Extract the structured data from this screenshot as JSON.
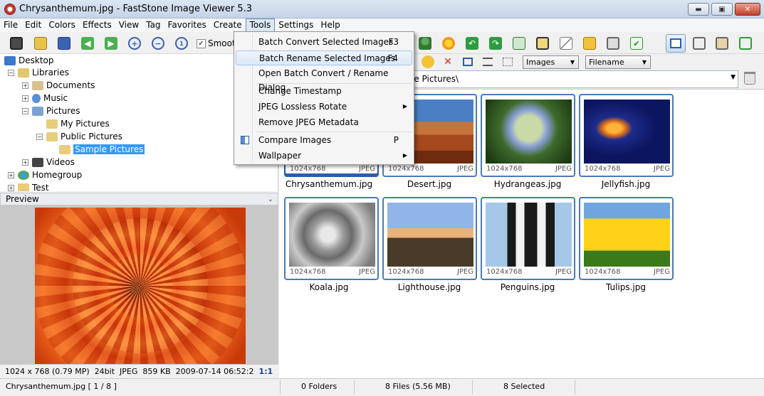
{
  "window": {
    "title": "Chrysanthemum.jpg - FastStone Image Viewer 5.3",
    "min_glyph": "▬",
    "max_glyph": "▣",
    "close_glyph": "✕"
  },
  "menubar": [
    "File",
    "Edit",
    "Colors",
    "Effects",
    "View",
    "Tag",
    "Favorites",
    "Create",
    "Tools",
    "Settings",
    "Help"
  ],
  "toolbar": {
    "smooth_label": "Smooth",
    "smooth_checked": "✓"
  },
  "tools_menu": {
    "items": [
      {
        "label": "Batch Convert Selected Images",
        "shortcut": "F3"
      },
      {
        "label": "Batch Rename Selected Images",
        "shortcut": "F4"
      },
      {
        "label": "Open Batch Convert / Rename Dialog",
        "shortcut": ""
      },
      {
        "label": "Change Timestamp",
        "shortcut": ""
      },
      {
        "label": "JPEG Lossless Rotate",
        "shortcut": ""
      },
      {
        "label": "Remove JPEG Metadata",
        "shortcut": ""
      },
      {
        "label": "Compare Images",
        "shortcut": "P"
      },
      {
        "label": "Wallpaper",
        "shortcut": ""
      }
    ],
    "submenu_arrow": "▶"
  },
  "tree": {
    "desktop": "Desktop",
    "libraries": "Libraries",
    "documents": "Documents",
    "music": "Music",
    "pictures": "Pictures",
    "my_pictures": "My Pictures",
    "public_pictures": "Public Pictures",
    "sample_pictures": "Sample Pictures",
    "videos": "Videos",
    "homegroup": "Homegroup",
    "test": "Test"
  },
  "preview": {
    "header": "Preview",
    "info": {
      "dimensions": "1024 x 768 (0.79 MP)",
      "bitdepth": "24bit",
      "format": "JPEG",
      "size": "859 KB",
      "date": "2009-07-14 06:52:2",
      "ratio": "1:1"
    }
  },
  "address": {
    "path": "le Pictures\\",
    "view_mode": "Images",
    "sort_by": "Filename"
  },
  "thumbnails": [
    {
      "name": "Chrysanthemum.jpg",
      "dims": "1024x768",
      "type": "JPEG"
    },
    {
      "name": "Desert.jpg",
      "dims": "1024x768",
      "type": "JPEG"
    },
    {
      "name": "Hydrangeas.jpg",
      "dims": "1024x768",
      "type": "JPEG"
    },
    {
      "name": "Jellyfish.jpg",
      "dims": "1024x768",
      "type": "JPEG"
    },
    {
      "name": "Koala.jpg",
      "dims": "1024x768",
      "type": "JPEG"
    },
    {
      "name": "Lighthouse.jpg",
      "dims": "1024x768",
      "type": "JPEG"
    },
    {
      "name": "Penguins.jpg",
      "dims": "1024x768",
      "type": "JPEG"
    },
    {
      "name": "Tulips.jpg",
      "dims": "1024x768",
      "type": "JPEG"
    }
  ],
  "statusbar": {
    "current_file": "Chrysanthemum.jpg [ 1 / 8 ]",
    "folders": "0 Folders",
    "files": "8 Files (5.56 MB)",
    "selected": "8 Selected"
  },
  "colors": {
    "accent": "#3399ff",
    "thumb_border": "#4a7ab5",
    "menu_hover": "#dbe8f8"
  }
}
